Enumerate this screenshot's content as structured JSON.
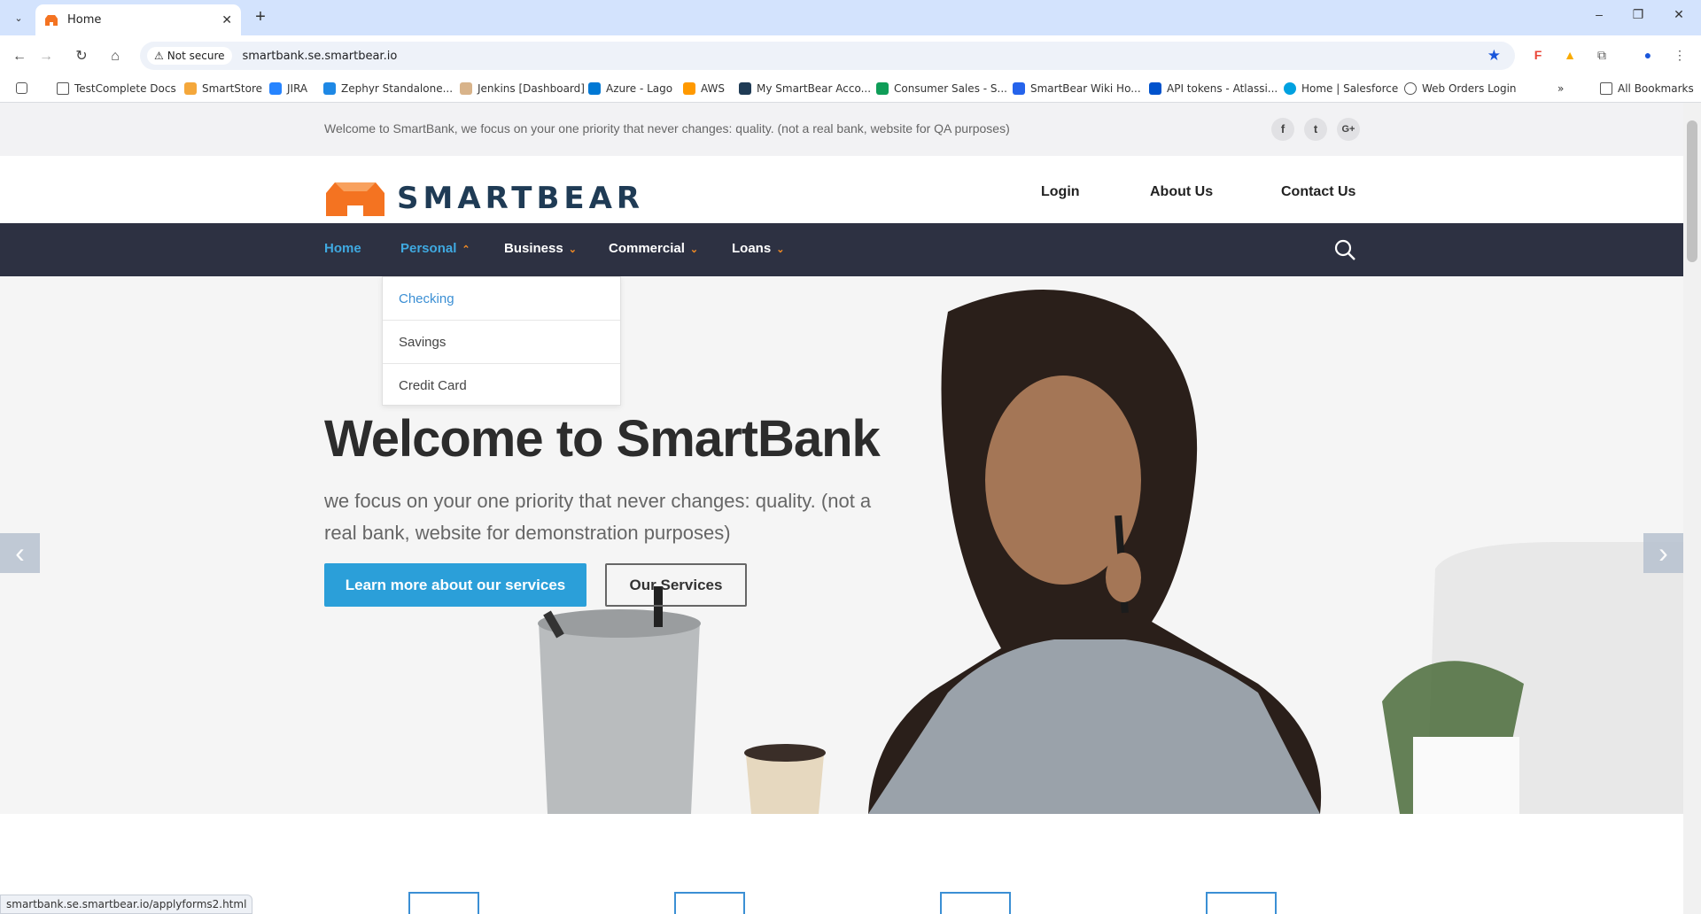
{
  "browser": {
    "tab_title": "Home",
    "tab_close": "✕",
    "new_tab": "+",
    "not_secure": "Not secure",
    "url": "smartbank.se.smartbear.io",
    "window_controls": [
      "–",
      "❐",
      "✕"
    ],
    "bookmarks": [
      {
        "label": "TestComplete Docs",
        "icon": "folder-icon"
      },
      {
        "label": "SmartStore",
        "icon": "smartstore-icon"
      },
      {
        "label": "JIRA",
        "icon": "jira-icon"
      },
      {
        "label": "Zephyr Standalone...",
        "icon": "zephyr-icon"
      },
      {
        "label": "Jenkins [Dashboard]",
        "icon": "jenkins-icon"
      },
      {
        "label": "Azure - Lago",
        "icon": "azure-icon"
      },
      {
        "label": "AWS",
        "icon": "aws-icon"
      },
      {
        "label": "My SmartBear Acco...",
        "icon": "smartbear-icon"
      },
      {
        "label": "Consumer Sales - S...",
        "icon": "sheets-icon"
      },
      {
        "label": "SmartBear Wiki Ho...",
        "icon": "wiki-icon"
      },
      {
        "label": "API tokens - Atlassi...",
        "icon": "atlassian-icon"
      },
      {
        "label": "Home | Salesforce",
        "icon": "salesforce-icon"
      },
      {
        "label": "Web Orders Login",
        "icon": "globe-icon"
      }
    ],
    "more_bookmarks": "»",
    "all_bookmarks": "All Bookmarks",
    "status_url": "smartbank.se.smartbear.io/applyforms2.html"
  },
  "site": {
    "top_message": "Welcome to SmartBank, we focus on your one priority that never changes: quality. (not a real bank, website for QA purposes)",
    "social": [
      "f",
      "t",
      "G+"
    ],
    "logo_text": "SMARTBEAR",
    "top_links": [
      "Login",
      "About Us",
      "Contact Us"
    ],
    "nav": [
      {
        "label": "Home",
        "caret": ""
      },
      {
        "label": "Personal",
        "caret": "⌃"
      },
      {
        "label": "Business",
        "caret": "⌄"
      },
      {
        "label": "Commercial",
        "caret": "⌄"
      },
      {
        "label": "Loans",
        "caret": "⌄"
      }
    ],
    "dropdown": [
      "Checking",
      "Savings",
      "Credit Card"
    ],
    "hero": {
      "title": "Welcome to SmartBank",
      "subtitle": "we focus on your one priority that never changes: quality. (not a real bank, website for demonstration purposes)",
      "primary_button": "Learn more about our services",
      "secondary_button": "Our Services",
      "prev": "‹",
      "next": "›"
    }
  },
  "colors": {
    "accent": "#2b9fd9",
    "nav_bg": "#2d3142",
    "brand_orange": "#f47321"
  }
}
